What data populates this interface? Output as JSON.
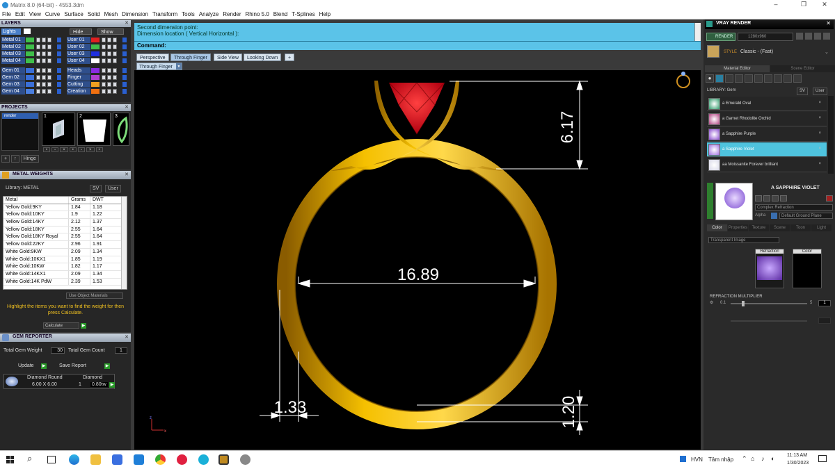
{
  "window": {
    "title": "Matrix 8.0 (64-bit) - 4553.3dm",
    "minimize": "–",
    "restore": "❐",
    "close": "✕"
  },
  "menu": [
    "File",
    "Edit",
    "View",
    "Curve",
    "Surface",
    "Solid",
    "Mesh",
    "Dimension",
    "Transform",
    "Tools",
    "Analyze",
    "Render",
    "Rhino 5.0",
    "Blend",
    "T-Splines",
    "Help"
  ],
  "layers": {
    "title": "LAYERS",
    "lights": "Lights",
    "hide": "Hide",
    "show": "Show",
    "left_rows": [
      {
        "name": "Metal 01",
        "color": "#3fbf4a"
      },
      {
        "name": "Metal 02",
        "color": "#3fbf4a"
      },
      {
        "name": "Metal 03",
        "color": "#3fbf4a"
      },
      {
        "name": "Metal 04",
        "color": "#3fbf4a"
      },
      {
        "name": "Gem 01",
        "color": "#3a6fd8"
      },
      {
        "name": "Gem 02",
        "color": "#3a6fd8"
      },
      {
        "name": "Gem 03",
        "color": "#3a6fd8"
      },
      {
        "name": "Gem 04",
        "color": "#4a7fe0"
      }
    ],
    "right_rows": [
      {
        "name": "User 01",
        "color": "#e02020"
      },
      {
        "name": "User 02",
        "color": "#3fbf4a"
      },
      {
        "name": "User 03",
        "color": "#2030e0"
      },
      {
        "name": "User 04",
        "color": "#ffffff"
      },
      {
        "name": "Heads",
        "color": "#8a2be2"
      },
      {
        "name": "Finger",
        "color": "#b040d0"
      },
      {
        "name": "Cutting",
        "color": "#f0a020"
      },
      {
        "name": "Creation",
        "color": "#f07010"
      }
    ]
  },
  "projects": {
    "title": "PROJECTS",
    "item": "render",
    "thumb_nums": [
      "1",
      "2",
      "3"
    ],
    "hinge": "Hinge"
  },
  "metal_weights": {
    "title": "METAL WEIGHTS",
    "library": "Library: METAL",
    "sv": "SV",
    "user": "User",
    "headers": [
      "Metal",
      "Grams",
      "DWT"
    ],
    "rows": [
      [
        "Yellow Gold:9KY",
        "1.84",
        "1.18"
      ],
      [
        "Yellow Gold:10KY",
        "1.9",
        "1.22"
      ],
      [
        "Yellow Gold:14KY",
        "2.12",
        "1.37"
      ],
      [
        "Yellow Gold:18KY",
        "2.55",
        "1.64"
      ],
      [
        "Yellow Gold:18KY Royal",
        "2.55",
        "1.64"
      ],
      [
        "Yellow Gold:22KY",
        "2.96",
        "1.91"
      ],
      [
        "White Gold:9KW",
        "2.09",
        "1.34"
      ],
      [
        "White Gold:10KX1",
        "1.85",
        "1.19"
      ],
      [
        "White Gold:10KW",
        "1.82",
        "1.17"
      ],
      [
        "White Gold:14KX1",
        "2.09",
        "1.34"
      ],
      [
        "White Gold:14K PdW",
        "2.39",
        "1.53"
      ]
    ],
    "use_object": "Use Object Materials",
    "hint": "Highlight the items you want to find the weight for then press Calculate.",
    "calculate": "Calculate"
  },
  "gem_reporter": {
    "title": "GEM REPORTER",
    "total_weight_label": "Total Gem Weight",
    "total_weight": "30",
    "total_count_label": "Total Gem Count",
    "total_count": "1",
    "update": "Update",
    "save_report": "Save Report",
    "col1": "Diamond Round",
    "col2": "Diamond",
    "size": "6.00 X 6.00",
    "qty": "1",
    "ct": "0.80tw"
  },
  "command": {
    "line1": "Second dimension point:",
    "line2": "Dimension location ( Vertical  Horizontal ):",
    "prompt": "Command:"
  },
  "view_tabs": [
    "Perspective",
    "Through Finger",
    "Side View",
    "Looking Down",
    "+"
  ],
  "active_view": "Through Finger",
  "dims": {
    "top": "6.17",
    "width": "16.89",
    "left": "1.33",
    "bottom": "1.20"
  },
  "vray": {
    "title": "VRAY RENDER",
    "render": "RENDER",
    "res": "1280x960",
    "style_label": "STYLE",
    "style": "Classic - (Fast)",
    "tabs": [
      "Material Editor",
      "Scene Editor"
    ],
    "library": "LIBRARY: Gem",
    "sv": "SV",
    "user": "User",
    "materials": [
      {
        "name": "a Emerald Oval",
        "color": "#2e9a6a"
      },
      {
        "name": "a Garnet Rhodolite Orchid",
        "color": "#b04080"
      },
      {
        "name": "a Sapphire Purple",
        "color": "#8a4ad0"
      },
      {
        "name": "a Sapphire Violet",
        "color": "#a070e0"
      },
      {
        "name": "aa Moissanite Forever brilliant",
        "color": "#d8d8e8"
      }
    ],
    "selected_index": 3,
    "preview_name": "A SAPPHIRE VIOLET",
    "complex": "Complex Refraction",
    "alpha": "Alpha",
    "ground": "Default Ground Plane",
    "subtabs": [
      "Color",
      "Properties",
      "Texture",
      "Scene",
      "Toon",
      "Light"
    ],
    "transparent": "Transparent Image",
    "refraction": "Refraction",
    "color": "Color",
    "refr_mult": "REFRACTION MULTIPLIER",
    "refr_min": "0.1",
    "refr_max": "5",
    "refr_val": "1",
    "x": "×"
  },
  "taskbar": {
    "lang": "HVN",
    "input": "Tâm nhập",
    "time": "11:13 AM",
    "date": "1/30/2023"
  }
}
